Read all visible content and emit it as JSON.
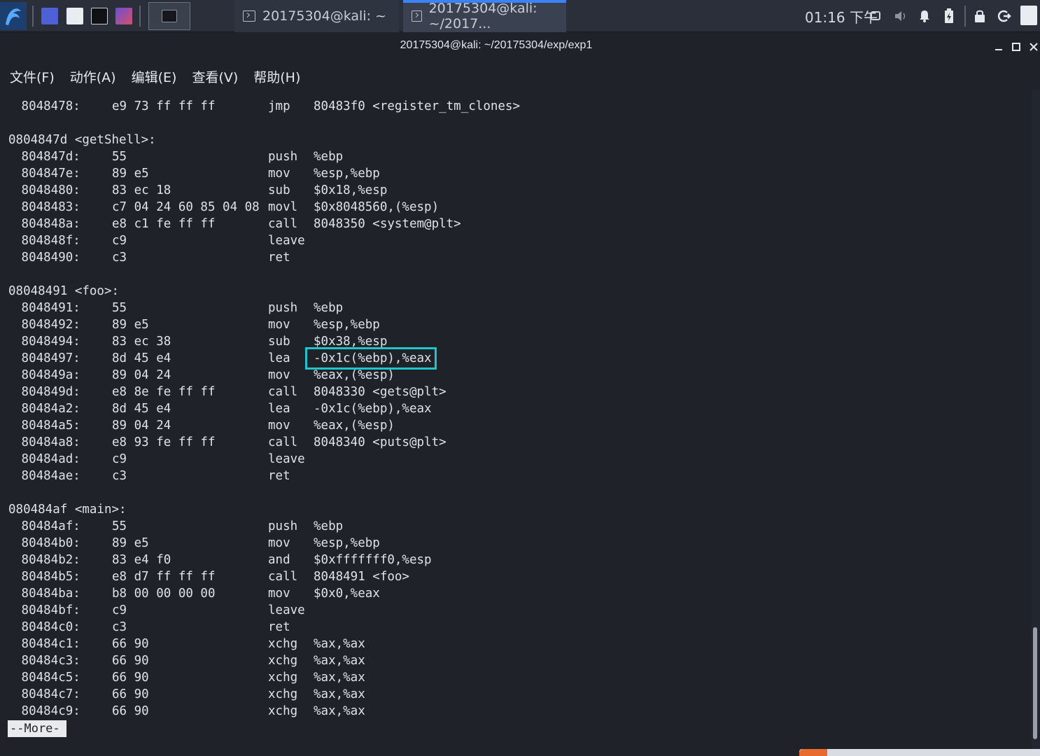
{
  "panel": {
    "clock": "01:16 下午",
    "tasks": [
      {
        "label": "20175304@kali: ~"
      },
      {
        "label": "20175304@kali: ~/2017..."
      }
    ]
  },
  "window": {
    "title": "20175304@kali: ~/20175304/exp/exp1"
  },
  "menubar": {
    "items": [
      "文件(F)",
      "动作(A)",
      "编辑(E)",
      "查看(V)",
      "帮助(H)"
    ]
  },
  "terminal": {
    "lines": [
      {
        "addr": " 8048478:",
        "bytes": "e9 73 ff ff ff",
        "op": "jmp",
        "args": "80483f0 <register_tm_clones>"
      },
      {
        "label": "0804847d <getShell>:"
      },
      {
        "addr": " 804847d:",
        "bytes": "55",
        "op": "push",
        "args": "%ebp"
      },
      {
        "addr": " 804847e:",
        "bytes": "89 e5",
        "op": "mov",
        "args": "%esp,%ebp"
      },
      {
        "addr": " 8048480:",
        "bytes": "83 ec 18",
        "op": "sub",
        "args": "$0x18,%esp"
      },
      {
        "addr": " 8048483:",
        "bytes": "c7 04 24 60 85 04 08",
        "op": "movl",
        "args": "$0x8048560,(%esp)"
      },
      {
        "addr": " 804848a:",
        "bytes": "e8 c1 fe ff ff",
        "op": "call",
        "args": "8048350 <system@plt>"
      },
      {
        "addr": " 804848f:",
        "bytes": "c9",
        "op": "leave",
        "args": ""
      },
      {
        "addr": " 8048490:",
        "bytes": "c3",
        "op": "ret",
        "args": ""
      },
      {
        "label": "08048491 <foo>:"
      },
      {
        "addr": " 8048491:",
        "bytes": "55",
        "op": "push",
        "args": "%ebp"
      },
      {
        "addr": " 8048492:",
        "bytes": "89 e5",
        "op": "mov",
        "args": "%esp,%ebp"
      },
      {
        "addr": " 8048494:",
        "bytes": "83 ec 38",
        "op": "sub",
        "args": "$0x38,%esp"
      },
      {
        "addr": " 8048497:",
        "bytes": "8d 45 e4",
        "op": "lea",
        "args": "-0x1c(%ebp),%eax"
      },
      {
        "addr": " 804849a:",
        "bytes": "89 04 24",
        "op": "mov",
        "args": "%eax,(%esp)"
      },
      {
        "addr": " 804849d:",
        "bytes": "e8 8e fe ff ff",
        "op": "call",
        "args": "8048330 <gets@plt>"
      },
      {
        "addr": " 80484a2:",
        "bytes": "8d 45 e4",
        "op": "lea",
        "args": "-0x1c(%ebp),%eax"
      },
      {
        "addr": " 80484a5:",
        "bytes": "89 04 24",
        "op": "mov",
        "args": "%eax,(%esp)"
      },
      {
        "addr": " 80484a8:",
        "bytes": "e8 93 fe ff ff",
        "op": "call",
        "args": "8048340 <puts@plt>"
      },
      {
        "addr": " 80484ad:",
        "bytes": "c9",
        "op": "leave",
        "args": ""
      },
      {
        "addr": " 80484ae:",
        "bytes": "c3",
        "op": "ret",
        "args": ""
      },
      {
        "label": "080484af <main>:"
      },
      {
        "addr": " 80484af:",
        "bytes": "55",
        "op": "push",
        "args": "%ebp"
      },
      {
        "addr": " 80484b0:",
        "bytes": "89 e5",
        "op": "mov",
        "args": "%esp,%ebp"
      },
      {
        "addr": " 80484b2:",
        "bytes": "83 e4 f0",
        "op": "and",
        "args": "$0xfffffff0,%esp"
      },
      {
        "addr": " 80484b5:",
        "bytes": "e8 d7 ff ff ff",
        "op": "call",
        "args": "8048491 <foo>"
      },
      {
        "addr": " 80484ba:",
        "bytes": "b8 00 00 00 00",
        "op": "mov",
        "args": "$0x0,%eax"
      },
      {
        "addr": " 80484bf:",
        "bytes": "c9",
        "op": "leave",
        "args": ""
      },
      {
        "addr": " 80484c0:",
        "bytes": "c3",
        "op": "ret",
        "args": ""
      },
      {
        "addr": " 80484c1:",
        "bytes": "66 90",
        "op": "xchg",
        "args": "%ax,%ax"
      },
      {
        "addr": " 80484c3:",
        "bytes": "66 90",
        "op": "xchg",
        "args": "%ax,%ax"
      },
      {
        "addr": " 80484c5:",
        "bytes": "66 90",
        "op": "xchg",
        "args": "%ax,%ax"
      },
      {
        "addr": " 80484c7:",
        "bytes": "66 90",
        "op": "xchg",
        "args": "%ax,%ax"
      },
      {
        "addr": " 80484c9:",
        "bytes": "66 90",
        "op": "xchg",
        "args": "%ax,%ax"
      }
    ],
    "pager_prompt": "--More--"
  },
  "colors": {
    "highlight": "#1fc4cc",
    "accent": "#3b82f6",
    "background": "#1f2229"
  },
  "icons": [
    "kali-dragon-icon",
    "terminal-icon",
    "display-icon",
    "volume-icon",
    "bell-icon",
    "battery-icon",
    "lock-icon",
    "logout-icon"
  ]
}
